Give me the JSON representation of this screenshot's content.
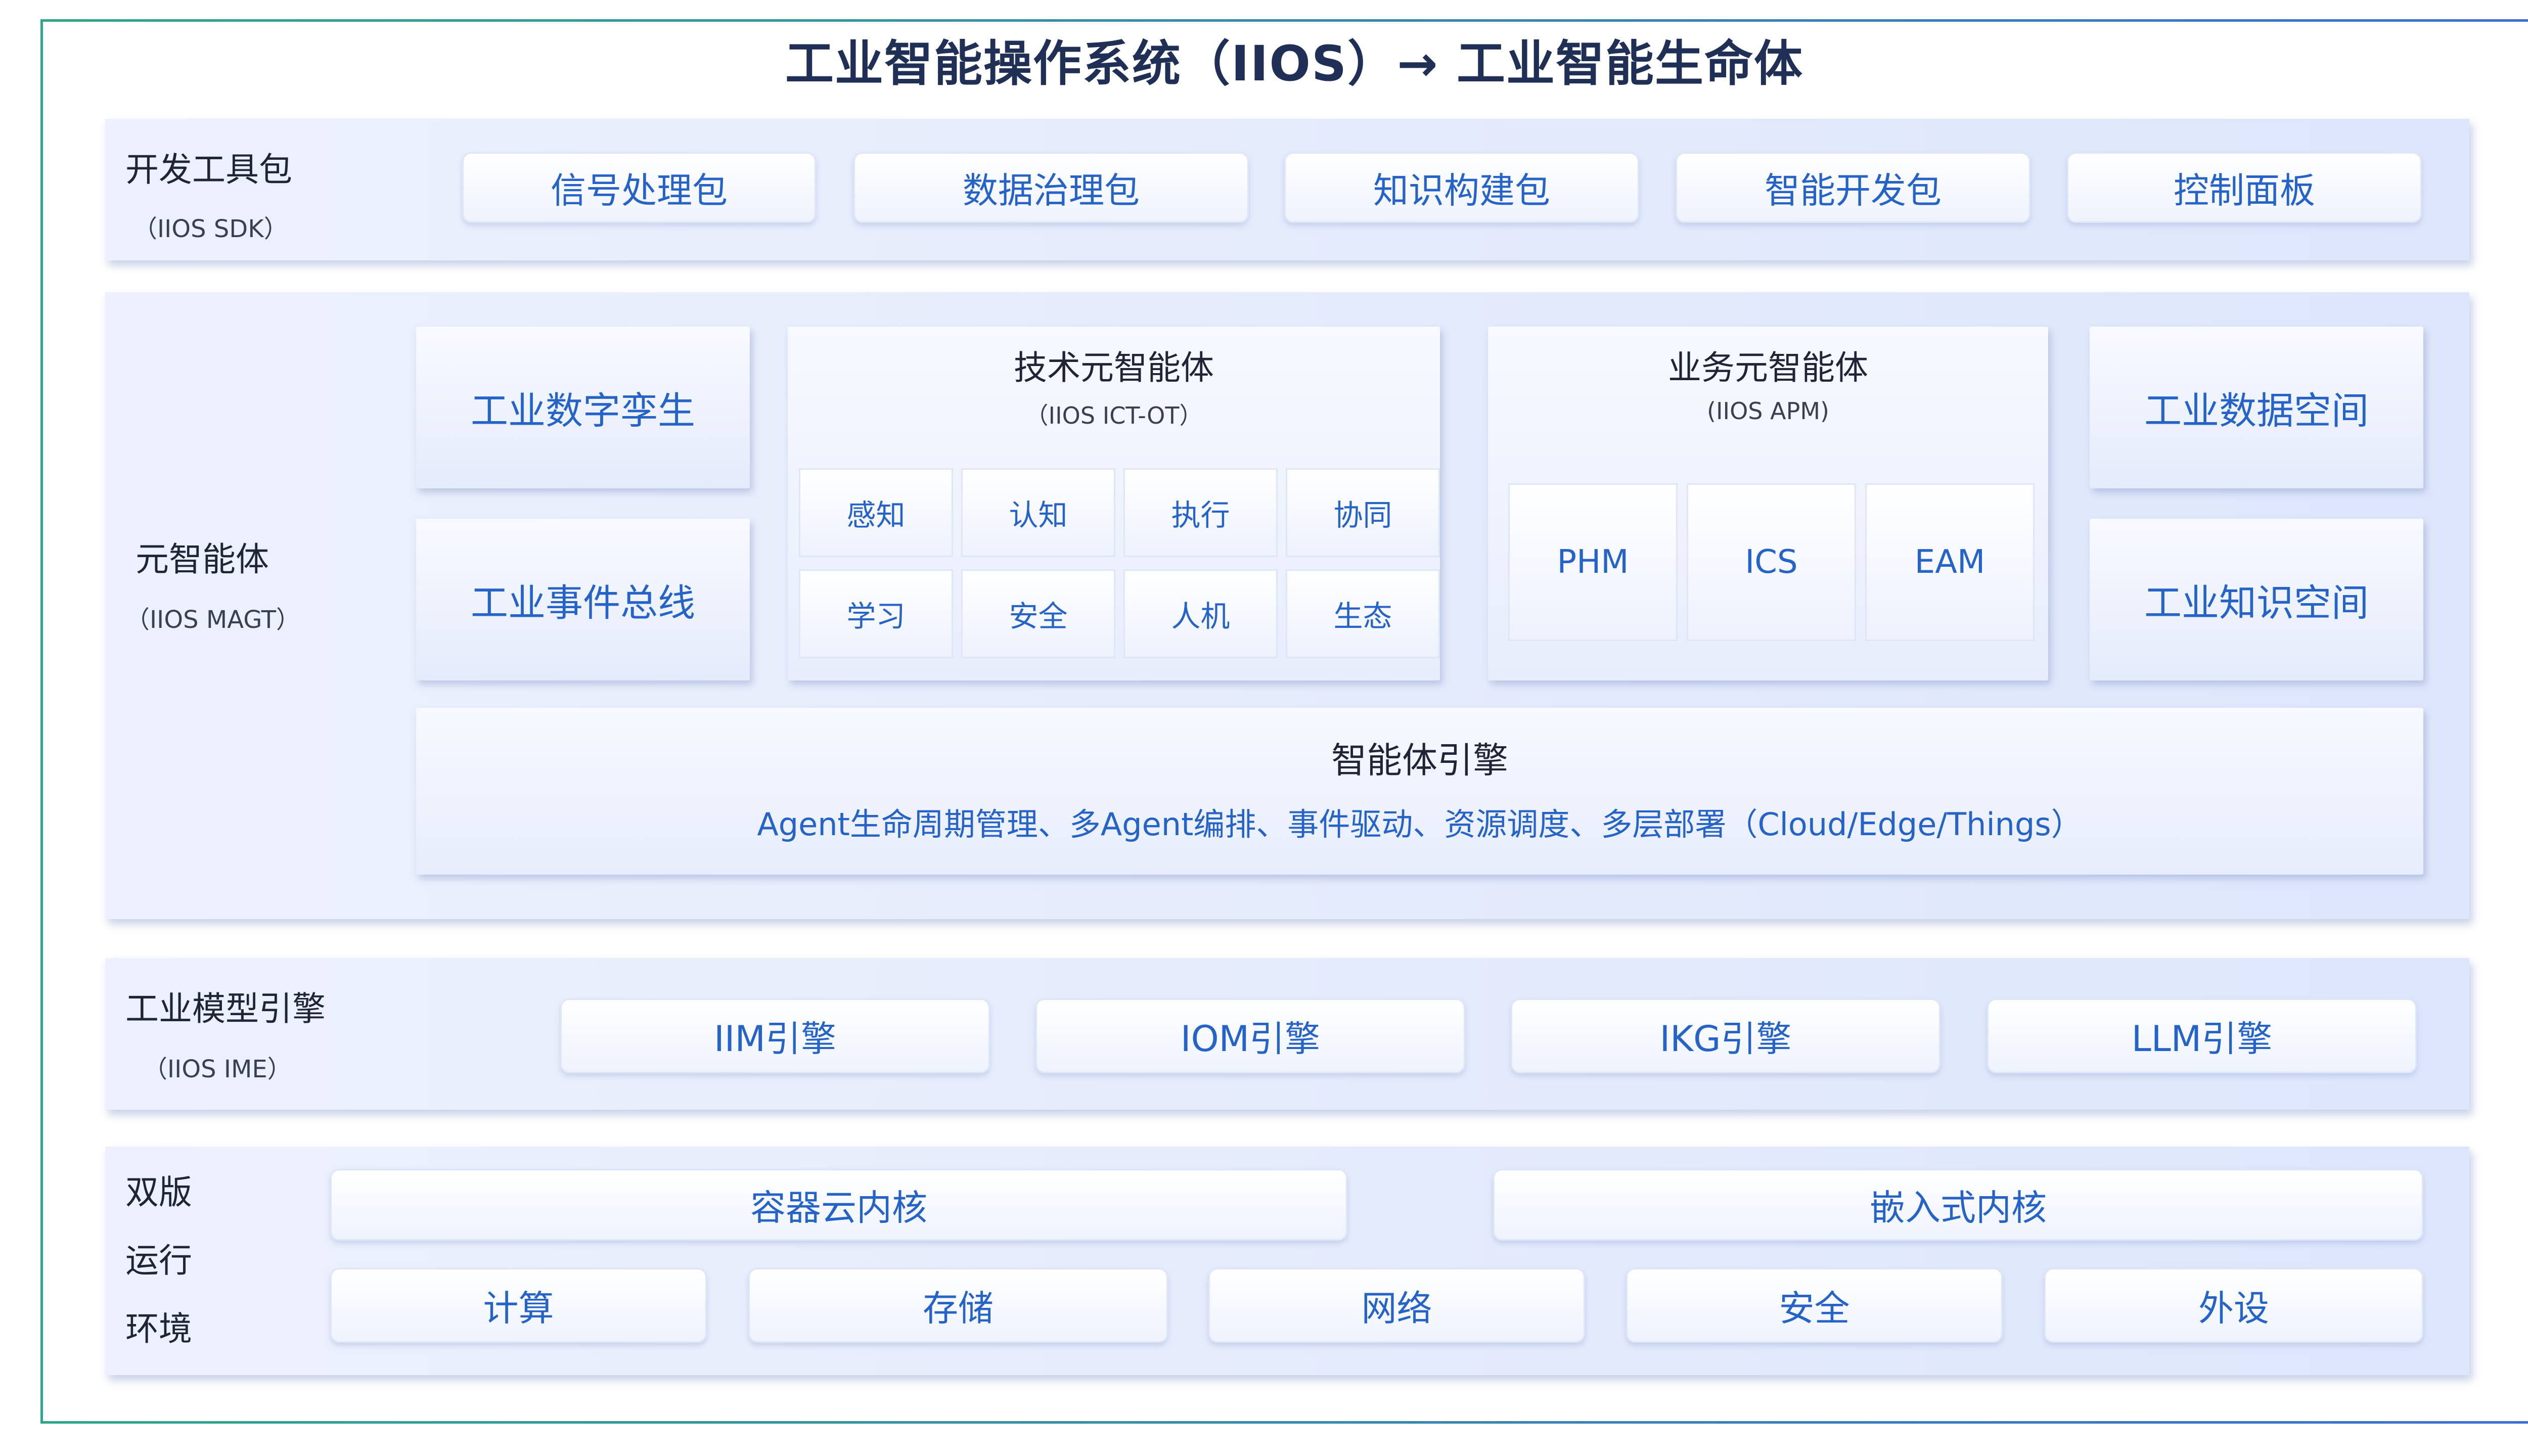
{
  "title": "工业智能操作系统（IIOS）→ 工业智能生命体",
  "sdk": {
    "label": "开发工具包",
    "sub": "（IIOS SDK）",
    "items": [
      "信号处理包",
      "数据治理包",
      "知识构建包",
      "智能开发包",
      "控制面板"
    ]
  },
  "magt": {
    "label": "元智能体",
    "sub": "（IIOS MAGT）",
    "left": [
      "工业数字孪生",
      "工业事件总线"
    ],
    "tech": {
      "title": "技术元智能体",
      "sub": "（IIOS ICT-OT）",
      "cells": [
        "感知",
        "认知",
        "执行",
        "协同",
        "学习",
        "安全",
        "人机",
        "生态"
      ]
    },
    "biz": {
      "title": "业务元智能体",
      "sub": "(IIOS APM)",
      "cells": [
        "PHM",
        "ICS",
        "EAM"
      ]
    },
    "right": [
      "工业数据空间",
      "工业知识空间"
    ],
    "engine": {
      "title": "智能体引擎",
      "desc": "Agent生命周期管理、多Agent编排、事件驱动、资源调度、多层部署（Cloud/Edge/Things）"
    }
  },
  "ime": {
    "label": "工业模型引擎",
    "sub": "（IIOS IME）",
    "items": [
      "IIM引擎",
      "IOM引擎",
      "IKG引擎",
      "LLM引擎"
    ]
  },
  "runtime": {
    "label_lines": [
      "双版",
      "运行",
      "环境"
    ],
    "kernels": [
      "容器云内核",
      "嵌入式内核"
    ],
    "items": [
      "计算",
      "存储",
      "网络",
      "安全",
      "外设"
    ]
  },
  "colors": {
    "accent": "#2563c9",
    "dark": "#1f2f55",
    "frame_start": "#2fa58a",
    "frame_end": "#3c6fd0"
  }
}
